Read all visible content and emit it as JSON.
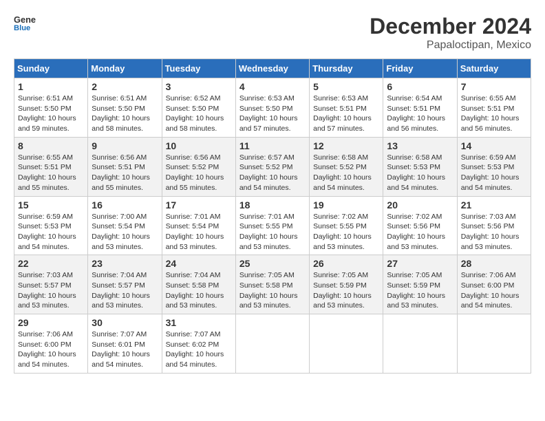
{
  "header": {
    "logo_line1": "General",
    "logo_line2": "Blue",
    "month": "December 2024",
    "location": "Papaloctipan, Mexico"
  },
  "weekdays": [
    "Sunday",
    "Monday",
    "Tuesday",
    "Wednesday",
    "Thursday",
    "Friday",
    "Saturday"
  ],
  "weeks": [
    [
      {
        "day": "1",
        "sunrise": "6:51 AM",
        "sunset": "5:50 PM",
        "daylight": "10 hours and 59 minutes."
      },
      {
        "day": "2",
        "sunrise": "6:51 AM",
        "sunset": "5:50 PM",
        "daylight": "10 hours and 58 minutes."
      },
      {
        "day": "3",
        "sunrise": "6:52 AM",
        "sunset": "5:50 PM",
        "daylight": "10 hours and 58 minutes."
      },
      {
        "day": "4",
        "sunrise": "6:53 AM",
        "sunset": "5:50 PM",
        "daylight": "10 hours and 57 minutes."
      },
      {
        "day": "5",
        "sunrise": "6:53 AM",
        "sunset": "5:51 PM",
        "daylight": "10 hours and 57 minutes."
      },
      {
        "day": "6",
        "sunrise": "6:54 AM",
        "sunset": "5:51 PM",
        "daylight": "10 hours and 56 minutes."
      },
      {
        "day": "7",
        "sunrise": "6:55 AM",
        "sunset": "5:51 PM",
        "daylight": "10 hours and 56 minutes."
      }
    ],
    [
      {
        "day": "8",
        "sunrise": "6:55 AM",
        "sunset": "5:51 PM",
        "daylight": "10 hours and 55 minutes."
      },
      {
        "day": "9",
        "sunrise": "6:56 AM",
        "sunset": "5:51 PM",
        "daylight": "10 hours and 55 minutes."
      },
      {
        "day": "10",
        "sunrise": "6:56 AM",
        "sunset": "5:52 PM",
        "daylight": "10 hours and 55 minutes."
      },
      {
        "day": "11",
        "sunrise": "6:57 AM",
        "sunset": "5:52 PM",
        "daylight": "10 hours and 54 minutes."
      },
      {
        "day": "12",
        "sunrise": "6:58 AM",
        "sunset": "5:52 PM",
        "daylight": "10 hours and 54 minutes."
      },
      {
        "day": "13",
        "sunrise": "6:58 AM",
        "sunset": "5:53 PM",
        "daylight": "10 hours and 54 minutes."
      },
      {
        "day": "14",
        "sunrise": "6:59 AM",
        "sunset": "5:53 PM",
        "daylight": "10 hours and 54 minutes."
      }
    ],
    [
      {
        "day": "15",
        "sunrise": "6:59 AM",
        "sunset": "5:53 PM",
        "daylight": "10 hours and 54 minutes."
      },
      {
        "day": "16",
        "sunrise": "7:00 AM",
        "sunset": "5:54 PM",
        "daylight": "10 hours and 53 minutes."
      },
      {
        "day": "17",
        "sunrise": "7:01 AM",
        "sunset": "5:54 PM",
        "daylight": "10 hours and 53 minutes."
      },
      {
        "day": "18",
        "sunrise": "7:01 AM",
        "sunset": "5:55 PM",
        "daylight": "10 hours and 53 minutes."
      },
      {
        "day": "19",
        "sunrise": "7:02 AM",
        "sunset": "5:55 PM",
        "daylight": "10 hours and 53 minutes."
      },
      {
        "day": "20",
        "sunrise": "7:02 AM",
        "sunset": "5:56 PM",
        "daylight": "10 hours and 53 minutes."
      },
      {
        "day": "21",
        "sunrise": "7:03 AM",
        "sunset": "5:56 PM",
        "daylight": "10 hours and 53 minutes."
      }
    ],
    [
      {
        "day": "22",
        "sunrise": "7:03 AM",
        "sunset": "5:57 PM",
        "daylight": "10 hours and 53 minutes."
      },
      {
        "day": "23",
        "sunrise": "7:04 AM",
        "sunset": "5:57 PM",
        "daylight": "10 hours and 53 minutes."
      },
      {
        "day": "24",
        "sunrise": "7:04 AM",
        "sunset": "5:58 PM",
        "daylight": "10 hours and 53 minutes."
      },
      {
        "day": "25",
        "sunrise": "7:05 AM",
        "sunset": "5:58 PM",
        "daylight": "10 hours and 53 minutes."
      },
      {
        "day": "26",
        "sunrise": "7:05 AM",
        "sunset": "5:59 PM",
        "daylight": "10 hours and 53 minutes."
      },
      {
        "day": "27",
        "sunrise": "7:05 AM",
        "sunset": "5:59 PM",
        "daylight": "10 hours and 53 minutes."
      },
      {
        "day": "28",
        "sunrise": "7:06 AM",
        "sunset": "6:00 PM",
        "daylight": "10 hours and 54 minutes."
      }
    ],
    [
      {
        "day": "29",
        "sunrise": "7:06 AM",
        "sunset": "6:00 PM",
        "daylight": "10 hours and 54 minutes."
      },
      {
        "day": "30",
        "sunrise": "7:07 AM",
        "sunset": "6:01 PM",
        "daylight": "10 hours and 54 minutes."
      },
      {
        "day": "31",
        "sunrise": "7:07 AM",
        "sunset": "6:02 PM",
        "daylight": "10 hours and 54 minutes."
      },
      null,
      null,
      null,
      null
    ]
  ]
}
